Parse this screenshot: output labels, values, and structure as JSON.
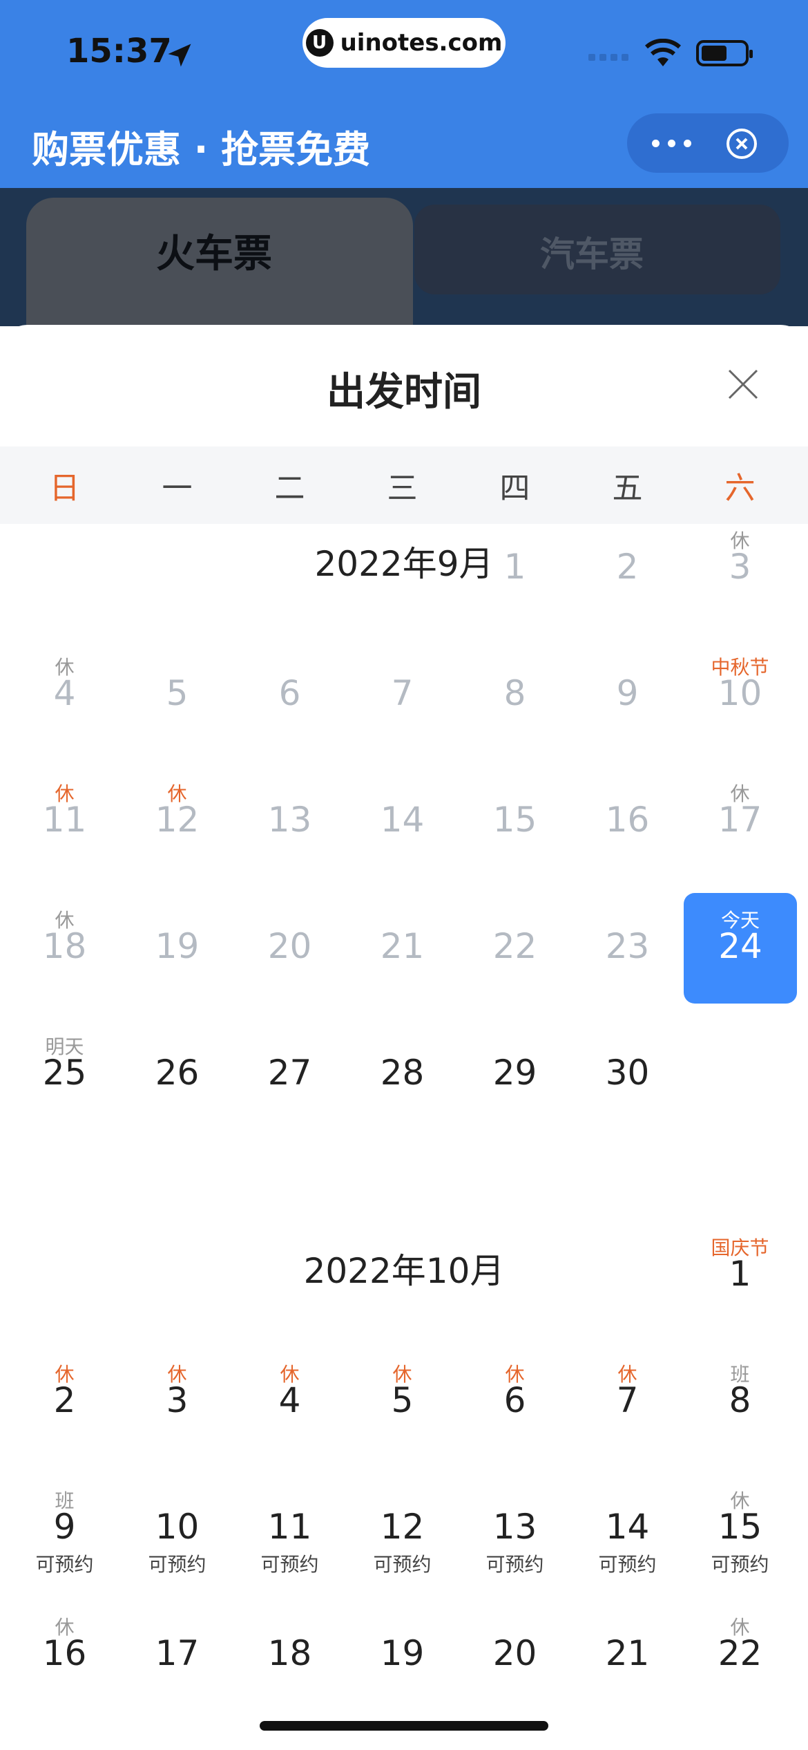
{
  "status": {
    "time": "15:37",
    "url": "uinotes.com"
  },
  "header": {
    "title": "购票优惠 · 抢票免费"
  },
  "tabs": [
    {
      "label": "火车票"
    },
    {
      "label": "汽车票"
    }
  ],
  "sheet": {
    "title": "出发时间"
  },
  "weekdays": [
    "日",
    "一",
    "二",
    "三",
    "四",
    "五",
    "六"
  ],
  "months": [
    {
      "title": "2022年9月",
      "weeks": [
        [
          {},
          {},
          {},
          {},
          {
            "day": "1",
            "past": true
          },
          {
            "day": "2",
            "past": true
          },
          {
            "day": "3",
            "tag": "休",
            "past": true
          }
        ],
        [
          {
            "day": "4",
            "tag": "休",
            "past": true
          },
          {
            "day": "5",
            "past": true
          },
          {
            "day": "6",
            "past": true
          },
          {
            "day": "7",
            "past": true
          },
          {
            "day": "8",
            "past": true
          },
          {
            "day": "9",
            "past": true
          },
          {
            "day": "10",
            "tag": "中秋节",
            "tag_red": true,
            "past": true
          }
        ],
        [
          {
            "day": "11",
            "tag": "休",
            "tag_red": true,
            "past": true
          },
          {
            "day": "12",
            "tag": "休",
            "tag_red": true,
            "past": true
          },
          {
            "day": "13",
            "past": true
          },
          {
            "day": "14",
            "past": true
          },
          {
            "day": "15",
            "past": true
          },
          {
            "day": "16",
            "past": true
          },
          {
            "day": "17",
            "tag": "休",
            "past": true
          }
        ],
        [
          {
            "day": "18",
            "tag": "休",
            "past": true
          },
          {
            "day": "19",
            "past": true
          },
          {
            "day": "20",
            "past": true
          },
          {
            "day": "21",
            "past": true
          },
          {
            "day": "22",
            "past": true
          },
          {
            "day": "23",
            "past": true
          },
          {
            "day": "24",
            "tag": "今天",
            "today": true
          }
        ],
        [
          {
            "day": "25",
            "tag": "明天"
          },
          {
            "day": "26"
          },
          {
            "day": "27"
          },
          {
            "day": "28"
          },
          {
            "day": "29"
          },
          {
            "day": "30"
          },
          {}
        ]
      ]
    },
    {
      "title": "2022年10月",
      "weeks": [
        [
          {},
          {},
          {},
          {},
          {},
          {},
          {
            "day": "1",
            "tag": "国庆节",
            "tag_red": true
          }
        ],
        [
          {
            "day": "2",
            "tag": "休",
            "tag_red": true
          },
          {
            "day": "3",
            "tag": "休",
            "tag_red": true
          },
          {
            "day": "4",
            "tag": "休",
            "tag_red": true
          },
          {
            "day": "5",
            "tag": "休",
            "tag_red": true
          },
          {
            "day": "6",
            "tag": "休",
            "tag_red": true
          },
          {
            "day": "7",
            "tag": "休",
            "tag_red": true
          },
          {
            "day": "8",
            "tag": "班"
          }
        ],
        [
          {
            "day": "9",
            "tag": "班",
            "sub": "可预约"
          },
          {
            "day": "10",
            "sub": "可预约"
          },
          {
            "day": "11",
            "sub": "可预约"
          },
          {
            "day": "12",
            "sub": "可预约"
          },
          {
            "day": "13",
            "sub": "可预约"
          },
          {
            "day": "14",
            "sub": "可预约"
          },
          {
            "day": "15",
            "tag": "休",
            "sub": "可预约"
          }
        ],
        [
          {
            "day": "16",
            "tag": "休"
          },
          {
            "day": "17"
          },
          {
            "day": "18"
          },
          {
            "day": "19"
          },
          {
            "day": "20"
          },
          {
            "day": "21"
          },
          {
            "day": "22",
            "tag": "休"
          }
        ]
      ]
    }
  ]
}
